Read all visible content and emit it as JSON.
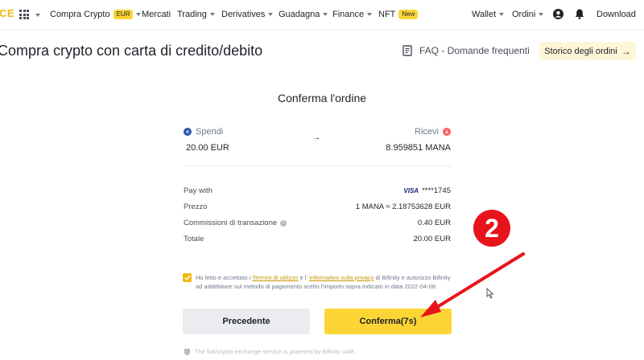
{
  "nav": {
    "logo_fragment": "CE",
    "items": [
      {
        "label": "Compra Crypto",
        "badge": "EUR",
        "caret": true
      },
      {
        "label": "Mercati",
        "caret": false
      },
      {
        "label": "Trading",
        "caret": true
      },
      {
        "label": "Derivatives",
        "caret": true
      },
      {
        "label": "Guadagna",
        "caret": true
      },
      {
        "label": "Finance",
        "caret": true
      },
      {
        "label": "NFT",
        "badge": "New",
        "caret": false
      }
    ],
    "wallet_label": "Wallet",
    "orders_label": "Ordini",
    "download_label": "Download"
  },
  "header": {
    "title": "Compra crypto con carta di credito/debito",
    "faq_label": "FAQ - Domande frequenti",
    "history_button": "Storico degli ordini",
    "history_arrow": "→"
  },
  "order": {
    "title": "Conferma l'ordine",
    "spend_label": "Spendi",
    "spend_value": "20.00 EUR",
    "flow_arrow": "→",
    "receive_label": "Ricevi",
    "receive_value": "8.959851 MANA",
    "rows": [
      {
        "label": "Pay with",
        "value": "****1745",
        "prefix": "VISA"
      },
      {
        "label": "Prezzo",
        "value": "1 MANA ≈ 2.18753628 EUR"
      },
      {
        "label": "Commissioni di transazione",
        "value": "0.40 EUR",
        "info": "i"
      },
      {
        "label": "Totale",
        "value": "20.00 EUR"
      }
    ]
  },
  "terms": {
    "checked": true,
    "text_1": "Ho letto e accettato i ",
    "link_terms": "Termini di utilizzo",
    "text_2": " e l' ",
    "link_privacy": "Informativa sulla privacy",
    "text_3": " di Bifinity e autorizzo Bifinity ad addebitare sul metodo di pagamento scelto l'importo sopra indicato in data 2022-04-08."
  },
  "buttons": {
    "previous": "Precedente",
    "confirm": "Conferma(7s)"
  },
  "footer": {
    "note": "The fiat/crypto exchange service is powered by Bifinity UAB."
  },
  "annotation": {
    "number": "2",
    "color": "#e8141b"
  },
  "colors": {
    "brand_yellow": "#fcd535",
    "link_gold": "#c99400",
    "text_dark": "#1e2329"
  }
}
